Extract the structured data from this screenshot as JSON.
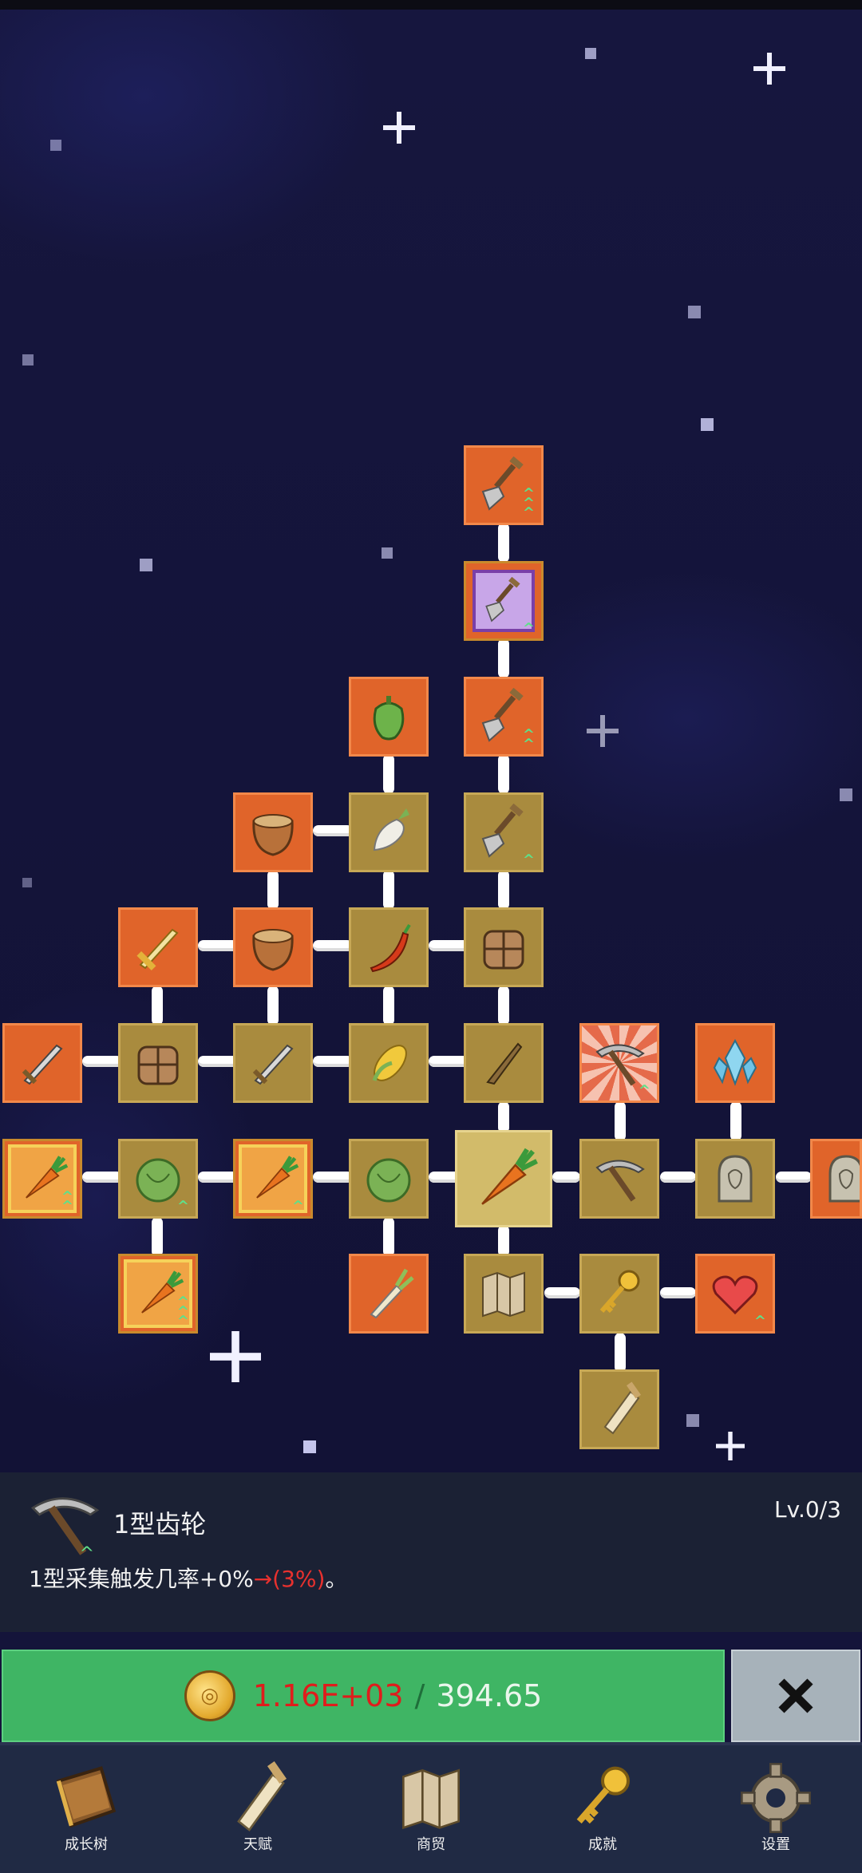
{
  "skill_tree": {
    "nodes": [
      {
        "id": "shovel-top",
        "icon": "shovel-icon",
        "color": "orange",
        "upgrades": "triple"
      },
      {
        "id": "shovel-purple",
        "icon": "shovel-icon",
        "color": "purple",
        "upgrades": "single"
      },
      {
        "id": "shovel-mid",
        "icon": "shovel-icon",
        "color": "orange",
        "upgrades": "double"
      },
      {
        "id": "shovel-low",
        "icon": "shovel-icon",
        "color": "tan",
        "upgrades": "single"
      },
      {
        "id": "pepper",
        "icon": "bell-pepper-icon",
        "color": "orange"
      },
      {
        "id": "radish",
        "icon": "radish-icon",
        "color": "tan"
      },
      {
        "id": "pot-1",
        "icon": "clay-pot-icon",
        "color": "orange"
      },
      {
        "id": "pot-2",
        "icon": "clay-pot-icon",
        "color": "orange"
      },
      {
        "id": "sword-gold",
        "icon": "golden-sword-icon",
        "color": "orange"
      },
      {
        "id": "chili",
        "icon": "chili-icon",
        "color": "tan"
      },
      {
        "id": "backpack-1",
        "icon": "backpack-icon",
        "color": "tan"
      },
      {
        "id": "sword-left",
        "icon": "sword-icon",
        "color": "orange"
      },
      {
        "id": "chest",
        "icon": "chest-icon",
        "color": "tan"
      },
      {
        "id": "sword-mid",
        "icon": "sword-icon",
        "color": "tan"
      },
      {
        "id": "corn",
        "icon": "corn-icon",
        "color": "tan"
      },
      {
        "id": "knife",
        "icon": "knife-icon",
        "color": "tan"
      },
      {
        "id": "pickaxe-burst",
        "icon": "pickaxe-icon",
        "color": "burst",
        "upgrades": "single"
      },
      {
        "id": "crystal",
        "icon": "crystal-icon",
        "color": "orange"
      },
      {
        "id": "carrot-1",
        "icon": "carrot-icon",
        "color": "gold",
        "upgrades": "double"
      },
      {
        "id": "cabbage-1",
        "icon": "cabbage-icon",
        "color": "tan",
        "upgrades": "single"
      },
      {
        "id": "carrot-2",
        "icon": "carrot-icon",
        "color": "gold",
        "upgrades": "single"
      },
      {
        "id": "cabbage-2",
        "icon": "cabbage-icon",
        "color": "tan"
      },
      {
        "id": "carrot-center",
        "icon": "carrot-icon",
        "color": "selected"
      },
      {
        "id": "pickaxe",
        "icon": "pickaxe-icon",
        "color": "tan"
      },
      {
        "id": "statue-1",
        "icon": "statue-icon",
        "color": "tan"
      },
      {
        "id": "statue-2",
        "icon": "statue-icon",
        "color": "orange"
      },
      {
        "id": "carrot-3",
        "icon": "carrot-icon",
        "color": "gold",
        "upgrades": "triple"
      },
      {
        "id": "leek",
        "icon": "leek-icon",
        "color": "orange"
      },
      {
        "id": "map",
        "icon": "map-icon",
        "color": "tan"
      },
      {
        "id": "key",
        "icon": "key-icon",
        "color": "tan"
      },
      {
        "id": "heart",
        "icon": "heart-icon",
        "color": "orange",
        "upgrades": "single"
      },
      {
        "id": "scroll",
        "icon": "scroll-icon",
        "color": "tan"
      }
    ]
  },
  "selected": {
    "icon": "pickaxe-icon",
    "name": "1型齿轮",
    "level": "Lv.0/3",
    "desc_main": "1型采集触发几率+0%",
    "desc_change": "→(3%)",
    "desc_end": "。"
  },
  "upgrade": {
    "cost": "1.16E+03",
    "separator": "/",
    "owned": "394.65",
    "coin_icon": "gold-coin-icon"
  },
  "close": {
    "icon": "close-x-icon"
  },
  "tabs": [
    {
      "label": "成长树",
      "icon": "book-icon"
    },
    {
      "label": "天赋",
      "icon": "scroll-icon"
    },
    {
      "label": "商贸",
      "icon": "map-icon"
    },
    {
      "label": "成就",
      "icon": "key-icon"
    },
    {
      "label": "设置",
      "icon": "gear-icon"
    }
  ],
  "colors": {
    "orange_node": "#e0642a",
    "tan_node": "#a98b3e",
    "upgrade_green": "#3fb564",
    "cost_red": "#e01c1c",
    "panel": "#1b2134"
  }
}
